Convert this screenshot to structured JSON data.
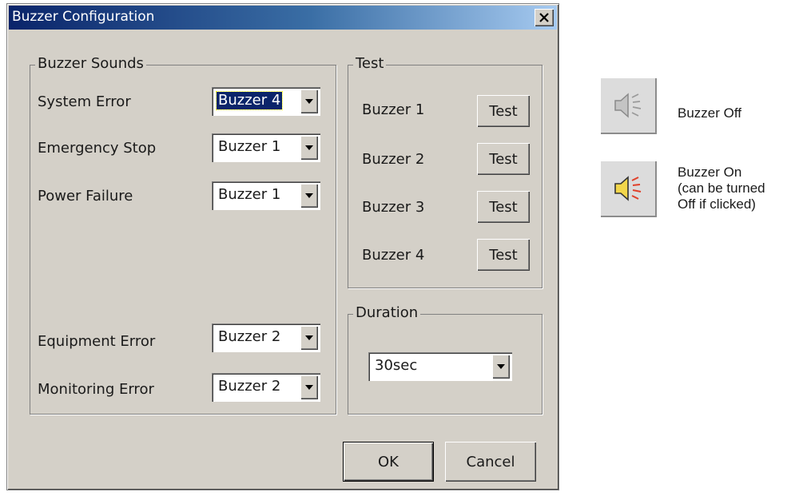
{
  "window": {
    "title": "Buzzer Configuration"
  },
  "buzzer_sounds": {
    "title": "Buzzer Sounds",
    "rows": [
      {
        "label": "System Error",
        "value": "Buzzer 4",
        "selected": true
      },
      {
        "label": "Emergency Stop",
        "value": "Buzzer 1"
      },
      {
        "label": "Power Failure",
        "value": "Buzzer 1"
      },
      {
        "label": "Equipment Error",
        "value": "Buzzer 2"
      },
      {
        "label": "Monitoring Error",
        "value": "Buzzer 2"
      }
    ]
  },
  "test": {
    "title": "Test",
    "rows": [
      {
        "label": "Buzzer 1",
        "button": "Test"
      },
      {
        "label": "Buzzer 2",
        "button": "Test"
      },
      {
        "label": "Buzzer 3",
        "button": "Test"
      },
      {
        "label": "Buzzer 4",
        "button": "Test"
      }
    ]
  },
  "duration": {
    "title": "Duration",
    "value": "30sec"
  },
  "footer": {
    "ok": "OK",
    "cancel": "Cancel"
  },
  "legend": {
    "off": {
      "icon": "speaker-muted-icon",
      "label": "Buzzer Off"
    },
    "on": {
      "icon": "speaker-sounding-icon",
      "line1": "Buzzer On",
      "line2": "(can be turned",
      "line3": "Off if clicked)"
    }
  },
  "colors": {
    "titlebar_start": "#0a246a",
    "titlebar_end": "#a6caf0",
    "face": "#d4d0c8",
    "speaker_on": "#f2d64a",
    "sound_waves_on": "#e0402a"
  }
}
